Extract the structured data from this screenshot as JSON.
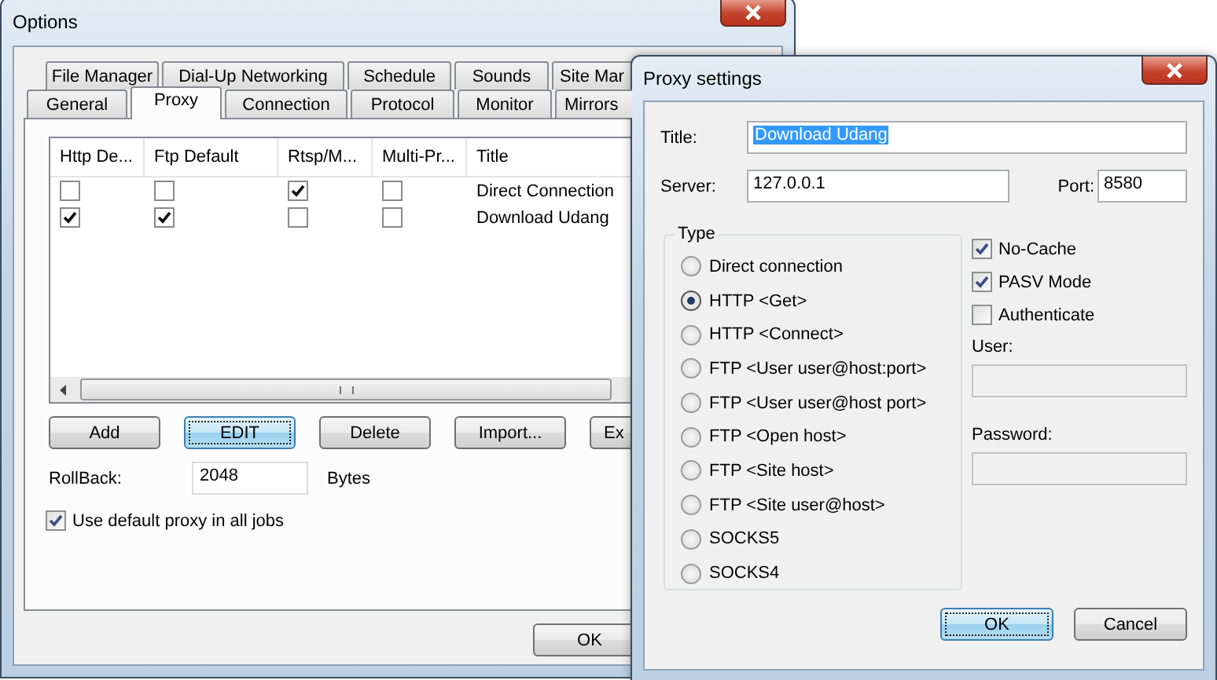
{
  "options_window": {
    "title": "Options",
    "tabs_row_1": [
      {
        "label": "File Manager",
        "selected": false
      },
      {
        "label": "Dial-Up Networking",
        "selected": false
      },
      {
        "label": "Schedule",
        "selected": false
      },
      {
        "label": "Sounds",
        "selected": false
      },
      {
        "label": "Site Mar",
        "selected": false
      }
    ],
    "tabs_row_2": [
      {
        "label": "General",
        "selected": false
      },
      {
        "label": "Proxy",
        "selected": true
      },
      {
        "label": "Connection",
        "selected": false
      },
      {
        "label": "Protocol",
        "selected": false
      },
      {
        "label": "Monitor",
        "selected": false
      },
      {
        "label": "Mirrors",
        "selected": false
      }
    ],
    "proxy_list": {
      "columns": [
        "Http De...",
        "Ftp Default",
        "Rtsp/M...",
        "Multi-Pr...",
        "Title"
      ],
      "rows": [
        {
          "checks": [
            false,
            false,
            true,
            false
          ],
          "title": "Direct Connection"
        },
        {
          "checks": [
            true,
            true,
            false,
            false
          ],
          "title": "Download Udang"
        }
      ]
    },
    "buttons": [
      {
        "label": "Add",
        "focused": false
      },
      {
        "label": "EDIT",
        "focused": true
      },
      {
        "label": "Delete",
        "focused": false
      },
      {
        "label": "Import...",
        "focused": false
      },
      {
        "label": "Ex",
        "focused": false
      }
    ],
    "rollback": {
      "label": "RollBack:",
      "value": "2048",
      "unit": "Bytes"
    },
    "use_default_proxy": {
      "label": "Use default proxy in all jobs",
      "checked": true
    },
    "ok_button": "OK"
  },
  "proxy_dialog": {
    "title": "Proxy settings",
    "title_field": {
      "label": "Title:",
      "value": "Download Udang",
      "selected": true
    },
    "server_field": {
      "label": "Server:",
      "value": "127.0.0.1"
    },
    "port_field": {
      "label": "Port:",
      "value": "8580"
    },
    "type_group": {
      "label": "Type",
      "options": [
        {
          "label": "Direct connection",
          "selected": false
        },
        {
          "label": "HTTP <Get>",
          "selected": true
        },
        {
          "label": "HTTP <Connect>",
          "selected": false
        },
        {
          "label": "FTP <User user@host:port>",
          "selected": false
        },
        {
          "label": "FTP <User user@host port>",
          "selected": false
        },
        {
          "label": "FTP <Open host>",
          "selected": false
        },
        {
          "label": "FTP <Site host>",
          "selected": false
        },
        {
          "label": "FTP <Site user@host>",
          "selected": false
        },
        {
          "label": "SOCKS5",
          "selected": false
        },
        {
          "label": "SOCKS4",
          "selected": false
        }
      ]
    },
    "checkboxes": [
      {
        "label": "No-Cache",
        "checked": true
      },
      {
        "label": "PASV Mode",
        "checked": true
      },
      {
        "label": "Authenticate",
        "checked": false
      }
    ],
    "user_field": {
      "label": "User:",
      "disabled": true
    },
    "password_field": {
      "label": "Password:",
      "disabled": true
    },
    "buttons": [
      {
        "label": "OK",
        "default": true
      },
      {
        "label": "Cancel",
        "default": false
      }
    ]
  }
}
